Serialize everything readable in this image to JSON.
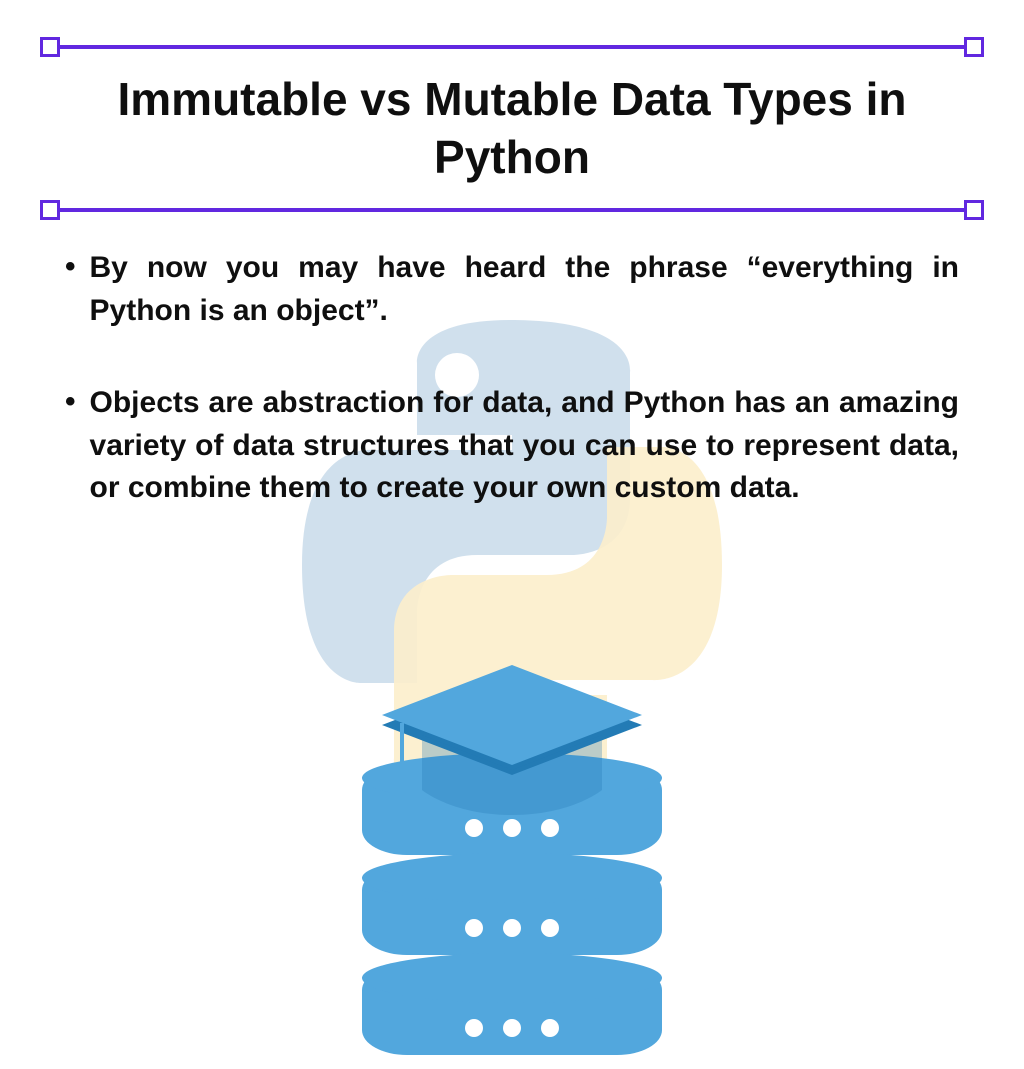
{
  "title": "Immutable vs Mutable Data Types in Python",
  "bullets": [
    "By now you may have heard the phrase “everything in Python is an object”.",
    "Objects are abstraction for data, and Python has an amazing variety of data structures that you can use to represent data, or combine them to create your own custom data."
  ],
  "colors": {
    "accent": "#6128e0",
    "text": "#0f0f0f",
    "python_blue": "#c8daea",
    "python_yellow": "#fceecb",
    "icon_blue": "#52a7dd"
  },
  "icons": {
    "python_logo": "python-logo-icon",
    "database": "database-stack-icon",
    "graduation_cap": "graduation-cap-icon"
  }
}
